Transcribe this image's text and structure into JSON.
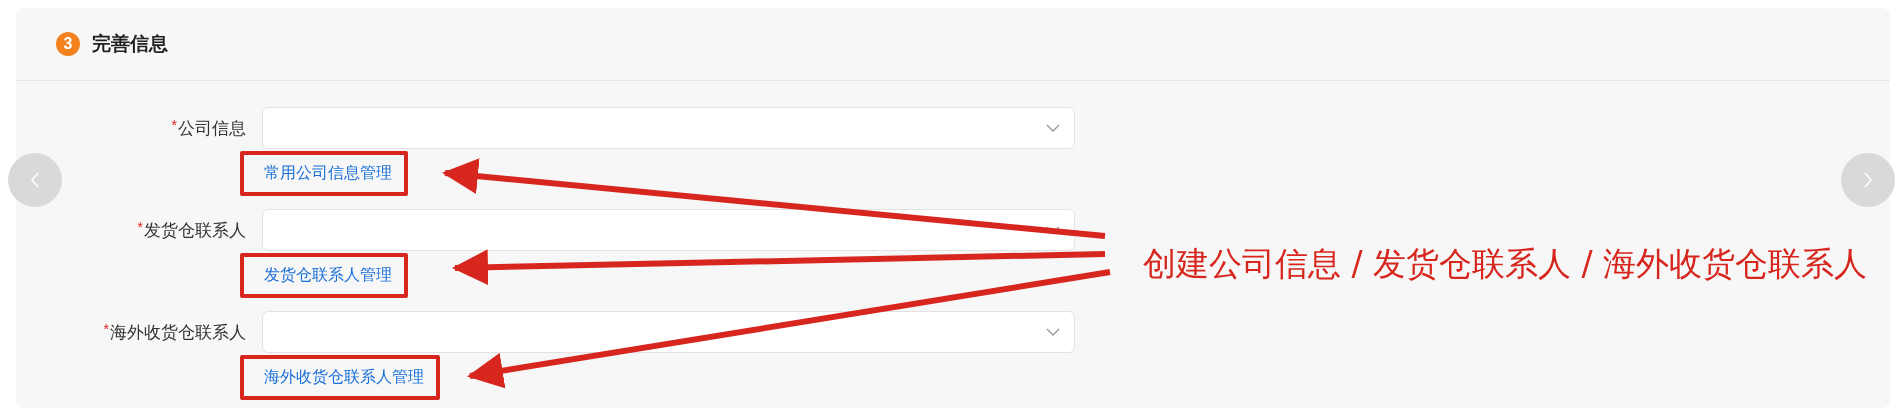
{
  "section": {
    "step": "3",
    "title": "完善信息"
  },
  "fields": [
    {
      "label": "公司信息",
      "required_mark": "*",
      "link": "常用公司信息管理",
      "annotated": true
    },
    {
      "label": "发货仓联系人",
      "required_mark": "*",
      "link": "发货仓联系人管理",
      "annotated": true
    },
    {
      "label": "海外收货仓联系人",
      "required_mark": "*",
      "link": "海外收货仓联系人管理",
      "annotated": true
    }
  ],
  "annotation": {
    "text": "创建公司信息 / 发货仓联系人 / 海外收货仓联系人"
  }
}
